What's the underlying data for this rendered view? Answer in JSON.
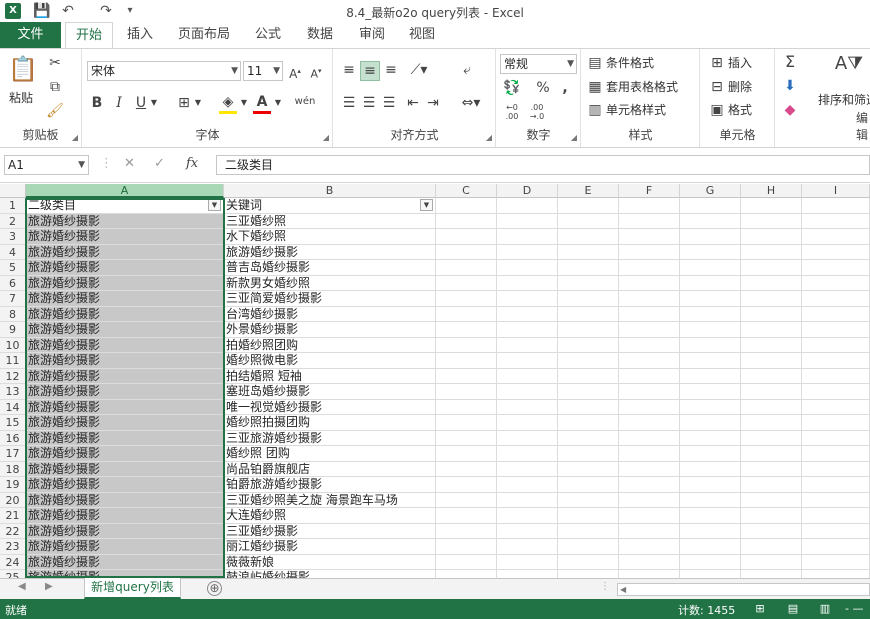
{
  "window": {
    "title": "8.4_最新o2o query列表 - Excel",
    "app_icon": "X"
  },
  "quick_access": {
    "save_icon": "💾",
    "undo_icon": "↶",
    "redo_icon": "↷",
    "customize_icon": "▾"
  },
  "tabs": {
    "file": "文件",
    "items": [
      "开始",
      "插入",
      "页面布局",
      "公式",
      "数据",
      "审阅",
      "视图"
    ]
  },
  "ribbon": {
    "clipboard": {
      "label": "剪贴板",
      "paste": "粘贴"
    },
    "font": {
      "label": "字体",
      "name": "宋体",
      "size": "11",
      "bold": "B",
      "italic": "I",
      "underline": "U"
    },
    "alignment": {
      "label": "对齐方式"
    },
    "number": {
      "label": "数字",
      "format": "常规",
      "percent": "%",
      "comma": ","
    },
    "styles": {
      "label": "样式",
      "conditional": "条件格式",
      "table": "套用表格格式",
      "cell": "单元格样式"
    },
    "cells": {
      "label": "单元格",
      "insert": "插入",
      "delete": "删除",
      "format": "格式"
    },
    "editing": {
      "label": "编辑",
      "sort_filter": "排序和筛选",
      "sum_icon": "Σ"
    }
  },
  "formula_bar": {
    "name_box": "A1",
    "cancel": "✕",
    "enter": "✓",
    "fx": "fx",
    "content": "二级类目"
  },
  "columns": [
    "A",
    "B",
    "C",
    "D",
    "E",
    "F",
    "G",
    "H",
    "I"
  ],
  "header_row": {
    "a": "二级类目",
    "b": "关键词"
  },
  "rows": [
    {
      "n": "2",
      "a": "旅游婚纱摄影",
      "b": "三亚婚纱照"
    },
    {
      "n": "3",
      "a": "旅游婚纱摄影",
      "b": "水下婚纱照"
    },
    {
      "n": "4",
      "a": "旅游婚纱摄影",
      "b": "旅游婚纱摄影"
    },
    {
      "n": "5",
      "a": "旅游婚纱摄影",
      "b": "普吉岛婚纱摄影"
    },
    {
      "n": "6",
      "a": "旅游婚纱摄影",
      "b": "新款男女婚纱照"
    },
    {
      "n": "7",
      "a": "旅游婚纱摄影",
      "b": "三亚简爱婚纱摄影"
    },
    {
      "n": "8",
      "a": "旅游婚纱摄影",
      "b": "台湾婚纱摄影"
    },
    {
      "n": "9",
      "a": "旅游婚纱摄影",
      "b": "外景婚纱摄影"
    },
    {
      "n": "10",
      "a": "旅游婚纱摄影",
      "b": "拍婚纱照团购"
    },
    {
      "n": "11",
      "a": "旅游婚纱摄影",
      "b": "婚纱照微电影"
    },
    {
      "n": "12",
      "a": "旅游婚纱摄影",
      "b": "拍结婚照 短袖"
    },
    {
      "n": "13",
      "a": "旅游婚纱摄影",
      "b": "塞班岛婚纱摄影"
    },
    {
      "n": "14",
      "a": "旅游婚纱摄影",
      "b": "唯一视觉婚纱摄影"
    },
    {
      "n": "15",
      "a": "旅游婚纱摄影",
      "b": "婚纱照拍摄团购"
    },
    {
      "n": "16",
      "a": "旅游婚纱摄影",
      "b": "三亚旅游婚纱摄影"
    },
    {
      "n": "17",
      "a": "旅游婚纱摄影",
      "b": "婚纱照 团购"
    },
    {
      "n": "18",
      "a": "旅游婚纱摄影",
      "b": "尚品铂爵旗舰店"
    },
    {
      "n": "19",
      "a": "旅游婚纱摄影",
      "b": "铂爵旅游婚纱摄影"
    },
    {
      "n": "20",
      "a": "旅游婚纱摄影",
      "b": "三亚婚纱照美之旋 海景跑车马场"
    },
    {
      "n": "21",
      "a": "旅游婚纱摄影",
      "b": "大连婚纱照"
    },
    {
      "n": "22",
      "a": "旅游婚纱摄影",
      "b": "三亚婚纱摄影"
    },
    {
      "n": "23",
      "a": "旅游婚纱摄影",
      "b": "丽江婚纱摄影"
    },
    {
      "n": "24",
      "a": "旅游婚纱摄影",
      "b": "薇薇新娘"
    },
    {
      "n": "25",
      "a": "旅游婚纱摄影",
      "b": "鼓浪屿婚纱摄影"
    }
  ],
  "sheet_tabs": {
    "active": "新增query列表",
    "add_icon": "⊕"
  },
  "status_bar": {
    "ready": "就绪",
    "count": "计数: 1455"
  },
  "colors": {
    "accent": "#217346",
    "selection_fill": "#c8c8c8",
    "header_selected": "#a8d8b5"
  }
}
